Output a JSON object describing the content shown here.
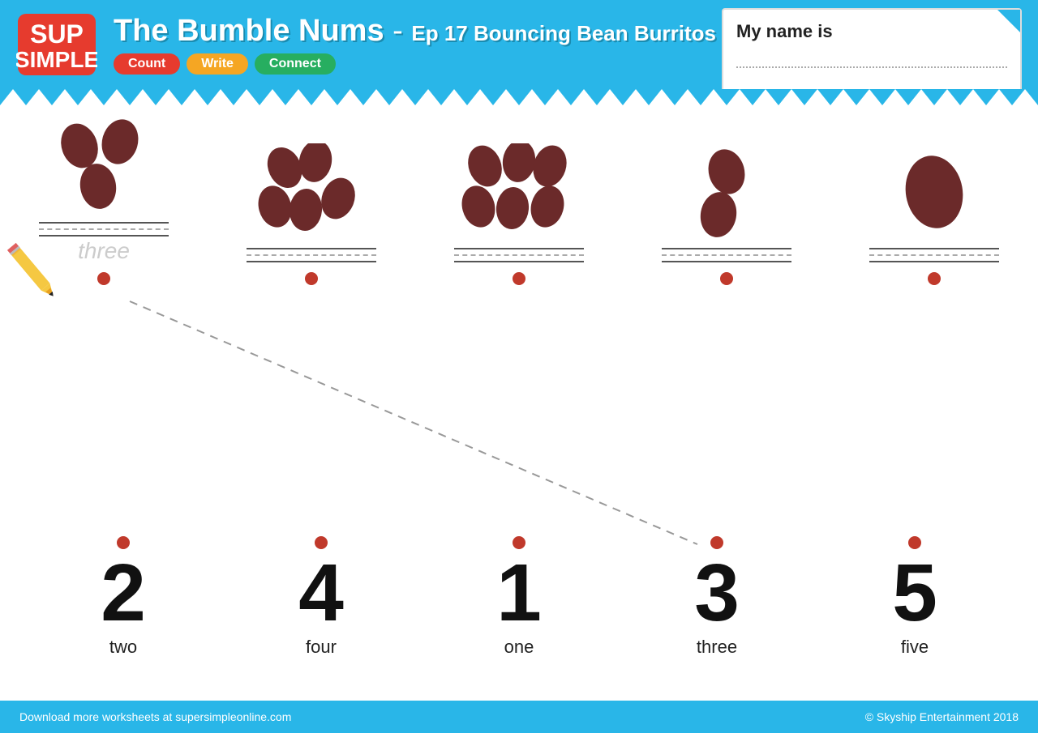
{
  "header": {
    "title": "The Bumble Nums",
    "subtitle": "Ep 17 Bouncing Bean Burritos",
    "tabs": [
      {
        "label": "Count",
        "color": "#e63b2e"
      },
      {
        "label": "Write",
        "color": "#f5a623"
      },
      {
        "label": "Connect",
        "color": "#27ae60"
      }
    ]
  },
  "nameCard": {
    "label": "My name is"
  },
  "beanGroups": [
    {
      "count": 3,
      "hint": "three"
    },
    {
      "count": 5,
      "hint": ""
    },
    {
      "count": 6,
      "hint": ""
    },
    {
      "count": 2,
      "hint": ""
    },
    {
      "count": 1,
      "hint": ""
    }
  ],
  "numberGroups": [
    {
      "number": "2",
      "word": "two"
    },
    {
      "number": "4",
      "word": "four"
    },
    {
      "number": "1",
      "word": "one"
    },
    {
      "number": "3",
      "word": "three"
    },
    {
      "number": "5",
      "word": "five"
    }
  ],
  "footer": {
    "left": "Download more worksheets at supersimpleonline.com",
    "right": "© Skyship Entertainment 2018"
  }
}
